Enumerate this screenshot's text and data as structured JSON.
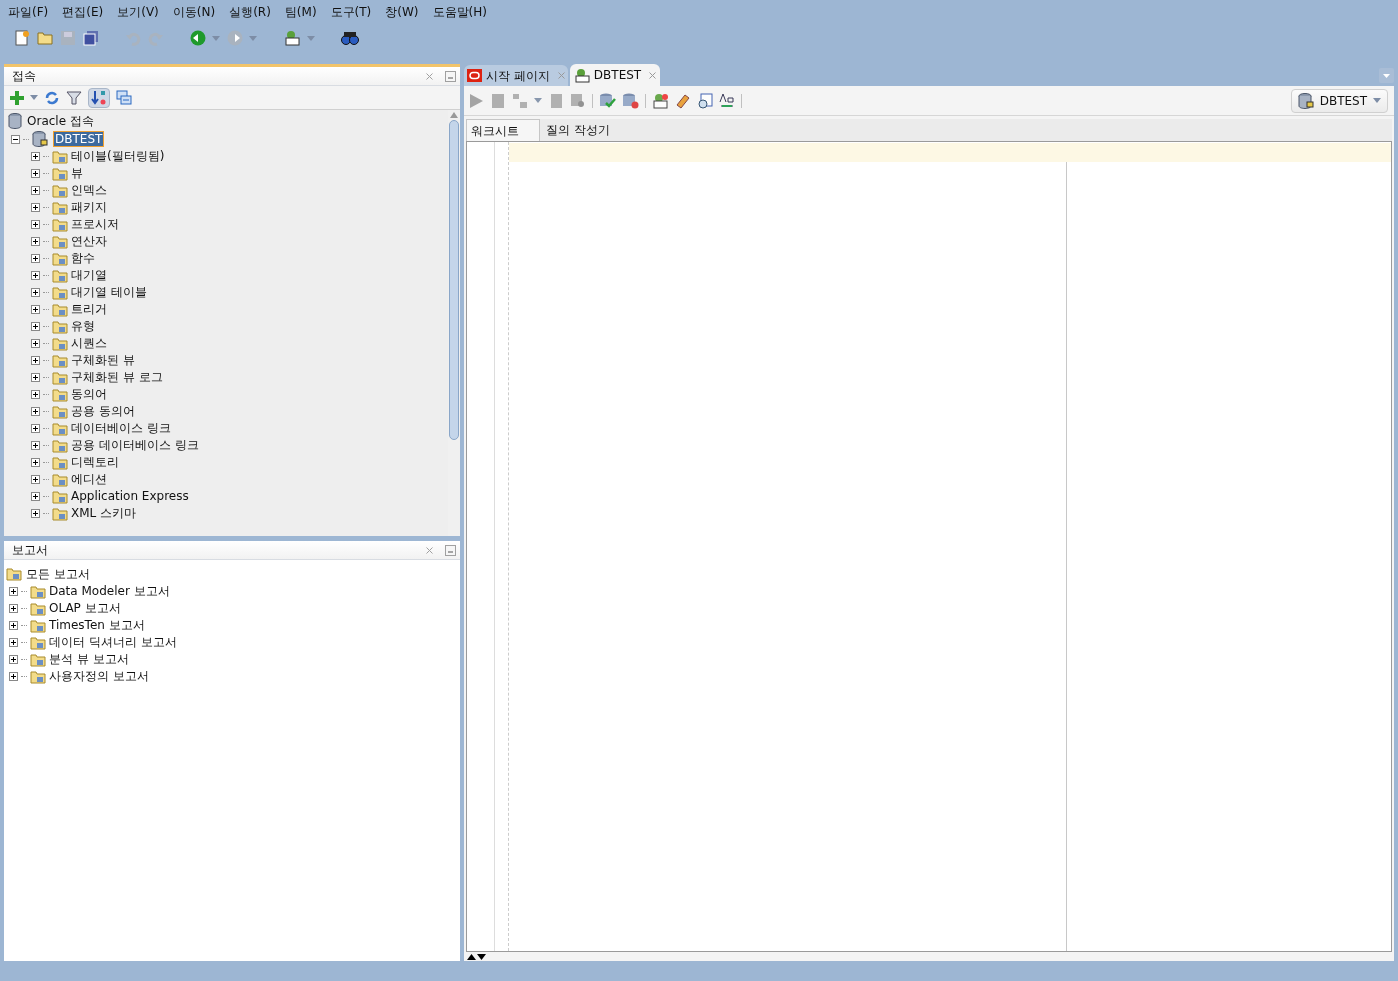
{
  "menu": [
    {
      "label": "파일(F)"
    },
    {
      "label": "편집(E)"
    },
    {
      "label": "보기(V)"
    },
    {
      "label": "이동(N)"
    },
    {
      "label": "실행(R)"
    },
    {
      "label": "팀(M)"
    },
    {
      "label": "도구(T)"
    },
    {
      "label": "창(W)"
    },
    {
      "label": "도움말(H)"
    }
  ],
  "main_toolbar": [
    {
      "kind": "new",
      "disabled": false
    },
    {
      "kind": "open",
      "disabled": false
    },
    {
      "kind": "save",
      "disabled": true
    },
    {
      "kind": "save-all",
      "disabled": false
    },
    {
      "kind": "sep"
    },
    {
      "kind": "undo",
      "disabled": true
    },
    {
      "kind": "redo",
      "disabled": true
    },
    {
      "kind": "sep"
    },
    {
      "kind": "back",
      "disabled": false
    },
    {
      "kind": "forward",
      "disabled": true
    },
    {
      "kind": "sep"
    },
    {
      "kind": "sql",
      "disabled": false
    },
    {
      "kind": "sep"
    },
    {
      "kind": "find",
      "disabled": false
    }
  ],
  "connections": {
    "title": "접속",
    "tree": {
      "label": "Oracle 접속",
      "children": [
        {
          "label": "DBTEST",
          "selected": true,
          "expanded": true,
          "children": [
            {
              "label": "테이블(필터링됨)",
              "expanded": false
            },
            {
              "label": "뷰",
              "expanded": false
            },
            {
              "label": "인덱스",
              "expanded": false
            },
            {
              "label": "패키지",
              "expanded": false
            },
            {
              "label": "프로시저",
              "expanded": false
            },
            {
              "label": "연산자",
              "expanded": false
            },
            {
              "label": "함수",
              "expanded": false
            },
            {
              "label": "대기열",
              "expanded": false
            },
            {
              "label": "대기열 테이블",
              "expanded": false
            },
            {
              "label": "트리거",
              "expanded": false
            },
            {
              "label": "유형",
              "expanded": false
            },
            {
              "label": "시퀀스",
              "expanded": false
            },
            {
              "label": "구체화된 뷰",
              "expanded": false
            },
            {
              "label": "구체화된 뷰 로그",
              "expanded": false
            },
            {
              "label": "동의어",
              "expanded": false
            },
            {
              "label": "공용 동의어",
              "expanded": false
            },
            {
              "label": "데이터베이스 링크",
              "expanded": false
            },
            {
              "label": "공용 데이터베이스 링크",
              "expanded": false
            },
            {
              "label": "디렉토리",
              "expanded": false
            },
            {
              "label": "에디션",
              "expanded": false
            },
            {
              "label": "Application Express",
              "expanded": false
            },
            {
              "label": "XML 스키마",
              "expanded": false
            }
          ]
        }
      ]
    }
  },
  "reports": {
    "title": "보고서",
    "tree": {
      "label": "모든 보고서",
      "children": [
        {
          "label": "Data Modeler 보고서",
          "expanded": false
        },
        {
          "label": "OLAP 보고서",
          "expanded": false
        },
        {
          "label": "TimesTen 보고서",
          "expanded": false
        },
        {
          "label": "데이터 딕셔너리 보고서",
          "expanded": false
        },
        {
          "label": "분석 뷰 보고서",
          "expanded": false
        },
        {
          "label": "사용자정의 보고서",
          "expanded": false
        }
      ]
    }
  },
  "editor": {
    "tabs": [
      {
        "label": "시작 페이지",
        "kind": "oracle",
        "selected": false
      },
      {
        "label": "DBTEST",
        "kind": "sql",
        "selected": true
      }
    ],
    "connection": "DBTEST",
    "subtabs": [
      {
        "label": "워크시트",
        "selected": true
      },
      {
        "label": "질의 작성기",
        "selected": false
      }
    ]
  }
}
